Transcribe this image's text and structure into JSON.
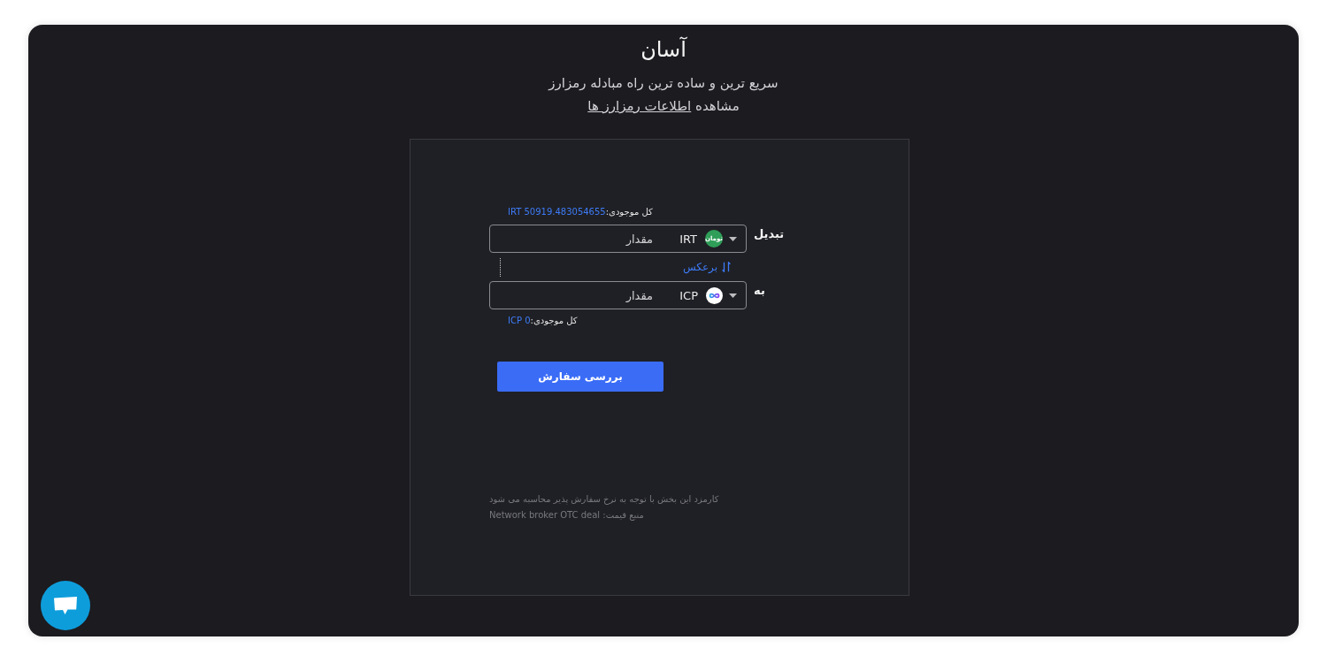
{
  "header": {
    "title": "آسان",
    "subtitle": "سریع ترین و ساده ترین راه مبادله رمزارز",
    "info": {
      "text": "مشاهده",
      "link": "اطلاعات رمزارز ها"
    }
  },
  "exchange": {
    "from": {
      "balance_label": "کل موجودی:",
      "balance": "IRT 50919.483054655",
      "label": "تبدیل",
      "currency": "IRT",
      "logo_text": "تومان",
      "placeholder": "مقدار"
    },
    "reverse": "برعکس",
    "to": {
      "label": "به",
      "currency": "ICP",
      "placeholder": "مقدار",
      "balance_label": "کل موجودی:",
      "balance": "ICP 0"
    },
    "submit": "بررسی سفارش",
    "notes": [
      "کارمزد این بخش با توجه به نرخ سفارش پذیر محاسبه می شود",
      "منبع قیمت: Network broker OTC deal"
    ]
  }
}
